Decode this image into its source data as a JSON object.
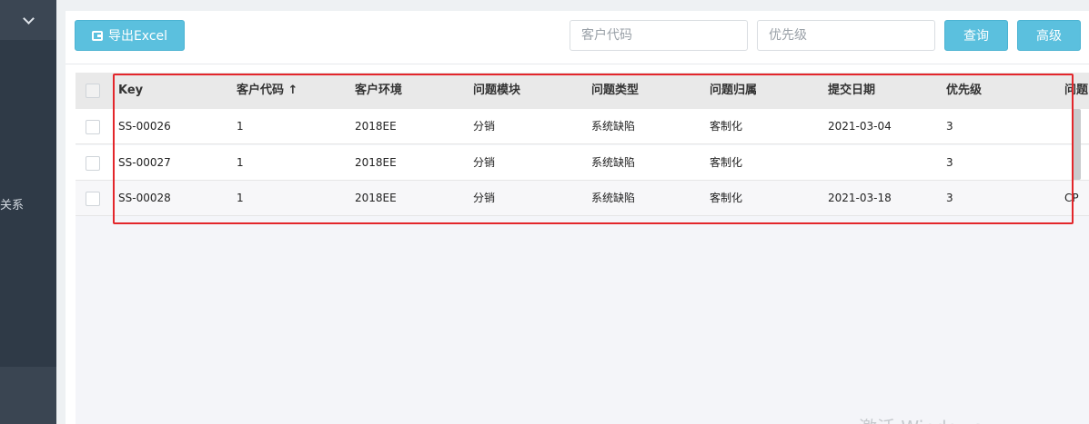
{
  "sidebar": {
    "menu_text": "关系"
  },
  "toolbar": {
    "export_label": "导出Excel",
    "customer_code_placeholder": "客户代码",
    "priority_placeholder": "优先级",
    "search_label": "查询",
    "advanced_label": "高级"
  },
  "table": {
    "columns": [
      "Key",
      "客户代码 ↑",
      "客户环境",
      "问题模块",
      "问题类型",
      "问题归属",
      "提交日期",
      "优先级",
      "问题"
    ],
    "rows": [
      [
        "SS-00026",
        "1",
        "2018EE",
        "分销",
        "系统缺陷",
        "客制化",
        "2021-03-04",
        "3",
        ""
      ],
      [
        "SS-00027",
        "1",
        "2018EE",
        "分销",
        "系统缺陷",
        "客制化",
        "",
        "3",
        ""
      ],
      [
        "SS-00028",
        "1",
        "2018EE",
        "分销",
        "系统缺陷",
        "客制化",
        "2021-03-18",
        "3",
        "CP"
      ]
    ]
  },
  "watermark": "激活 Windows",
  "colors": {
    "accent": "#5bc0de",
    "highlight": "#e3262b",
    "sidebar": "#2f3a47"
  }
}
